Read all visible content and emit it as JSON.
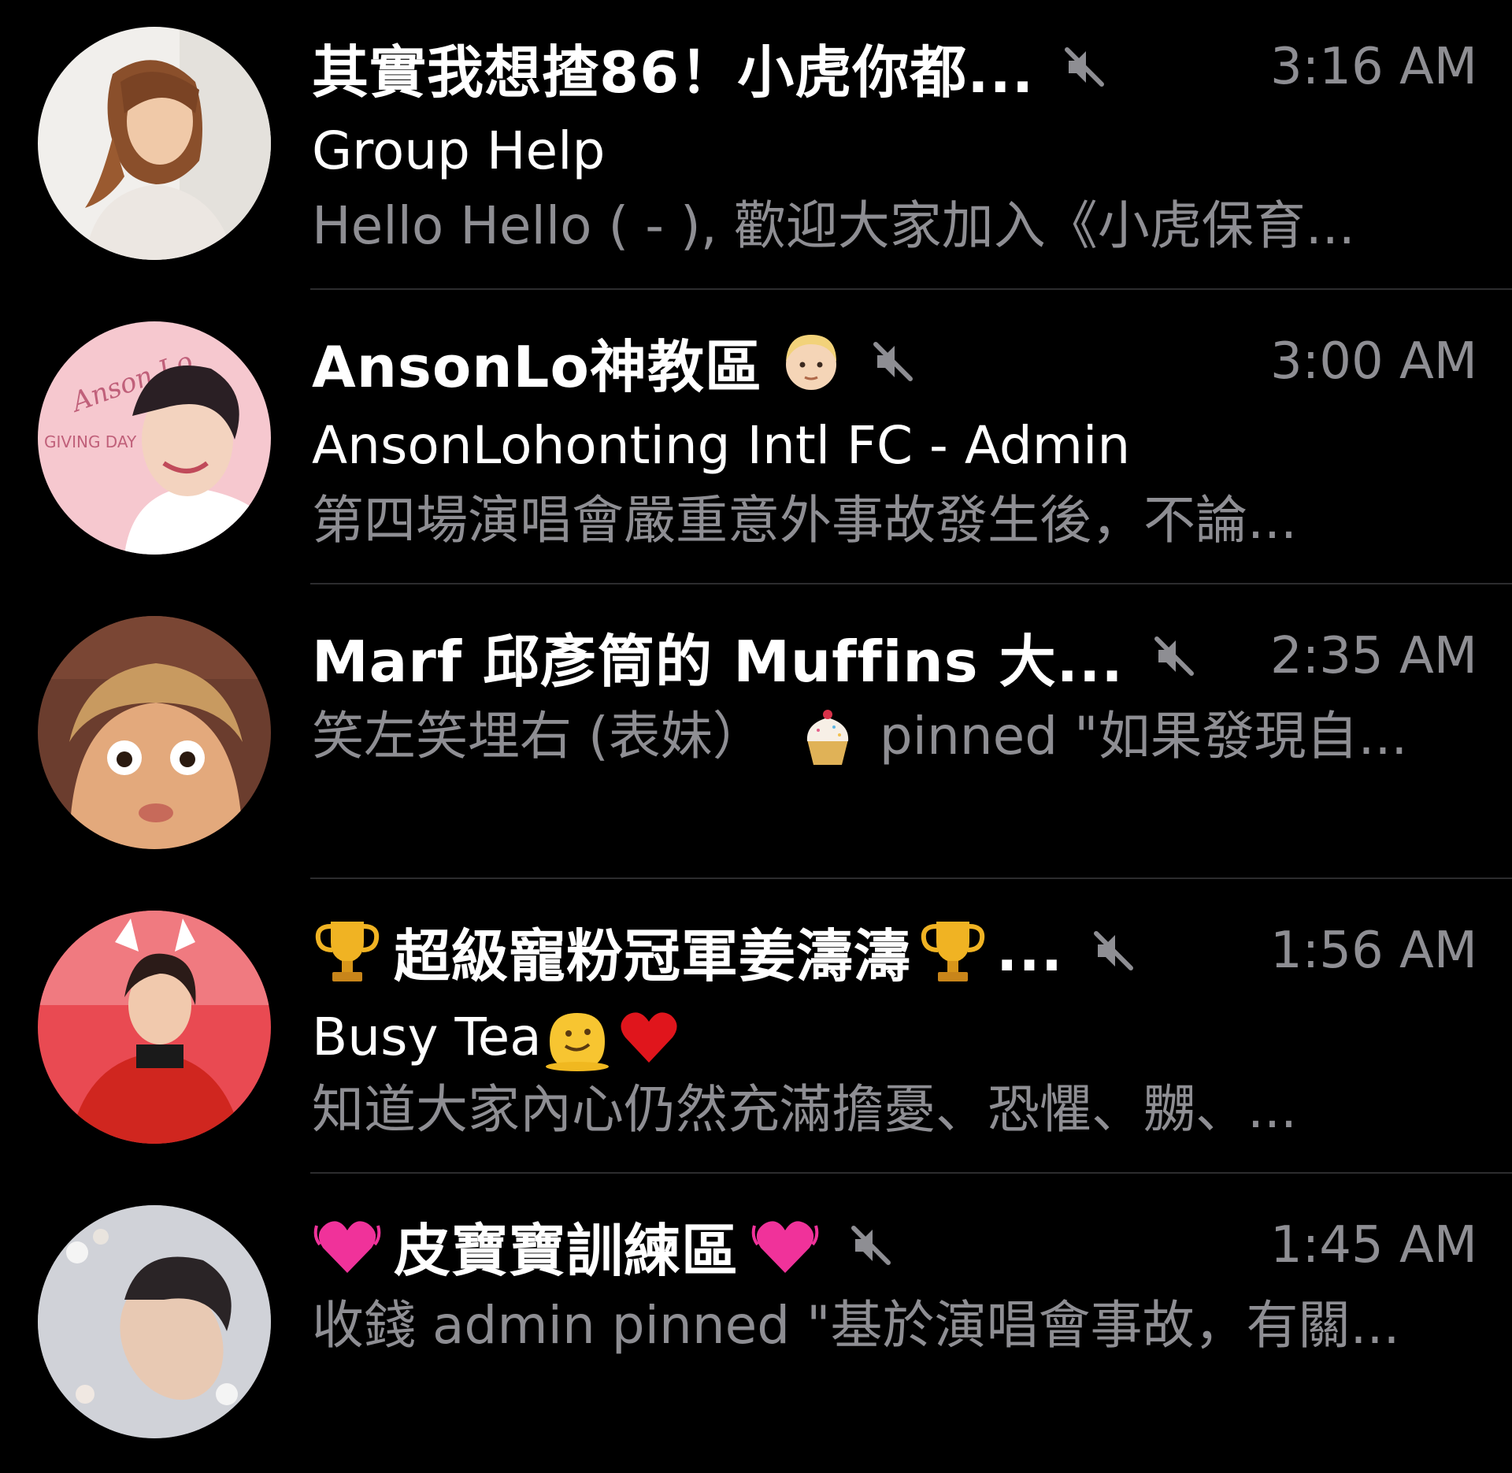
{
  "chats": [
    {
      "title": "其實我想揸86！小虎你都...",
      "time": "3:16 AM",
      "sender": "Group Help",
      "preview": "Hello Hello ( - ), 歡迎大家加入《小虎保育...",
      "muted": true,
      "avatar_icon": "avatar-woman-photo"
    },
    {
      "title": "AnsonLo神教區",
      "title_emoji": "blond-person-emoji",
      "time": "3:00 AM",
      "sender": "AnsonLohonting Intl FC - Admin",
      "preview": "第四場演唱會嚴重意外事故發生後，不論...",
      "muted": true,
      "avatar_icon": "avatar-anson-lo-giving-day",
      "avatar_logo_text": "Anson Lo",
      "avatar_badge_text": "GIVING DAY"
    },
    {
      "title": "Marf 邱彥筒的 Muffins 大...",
      "time": "2:35 AM",
      "preview_prefix": "笑左笑埋右 (表妹）",
      "preview_emoji": "cupcake-emoji",
      "preview_suffix": "pinned \"如果發現自...",
      "muted": true,
      "avatar_icon": "avatar-surprised-face-photo"
    },
    {
      "title_prefix_emoji": "trophy-emoji",
      "title": "超級寵粉冠軍姜濤濤",
      "title_suffix_emoji": "trophy-emoji",
      "title_ellipsis": "...",
      "time": "1:56 AM",
      "sender": "Busy Tea",
      "sender_emojis": [
        "melting-face-emoji",
        "red-heart-emoji"
      ],
      "preview": "知道大家內心仍然充滿擔憂、恐懼、嬲、...",
      "muted": true,
      "avatar_icon": "avatar-cat-ears-red-photo"
    },
    {
      "title_prefix_emoji": "beating-heart-emoji",
      "title": "皮寶寶訓練區",
      "title_suffix_emoji": "beating-heart-emoji",
      "time": "1:45 AM",
      "preview": "收錢 admin pinned \"基於演唱會事故，有關...",
      "muted": true,
      "avatar_icon": "avatar-flowers-portrait-photo"
    }
  ],
  "colors": {
    "background": "#000000",
    "title": "#ffffff",
    "secondary": "#8e8e93",
    "divider": "#2c2c2e"
  }
}
